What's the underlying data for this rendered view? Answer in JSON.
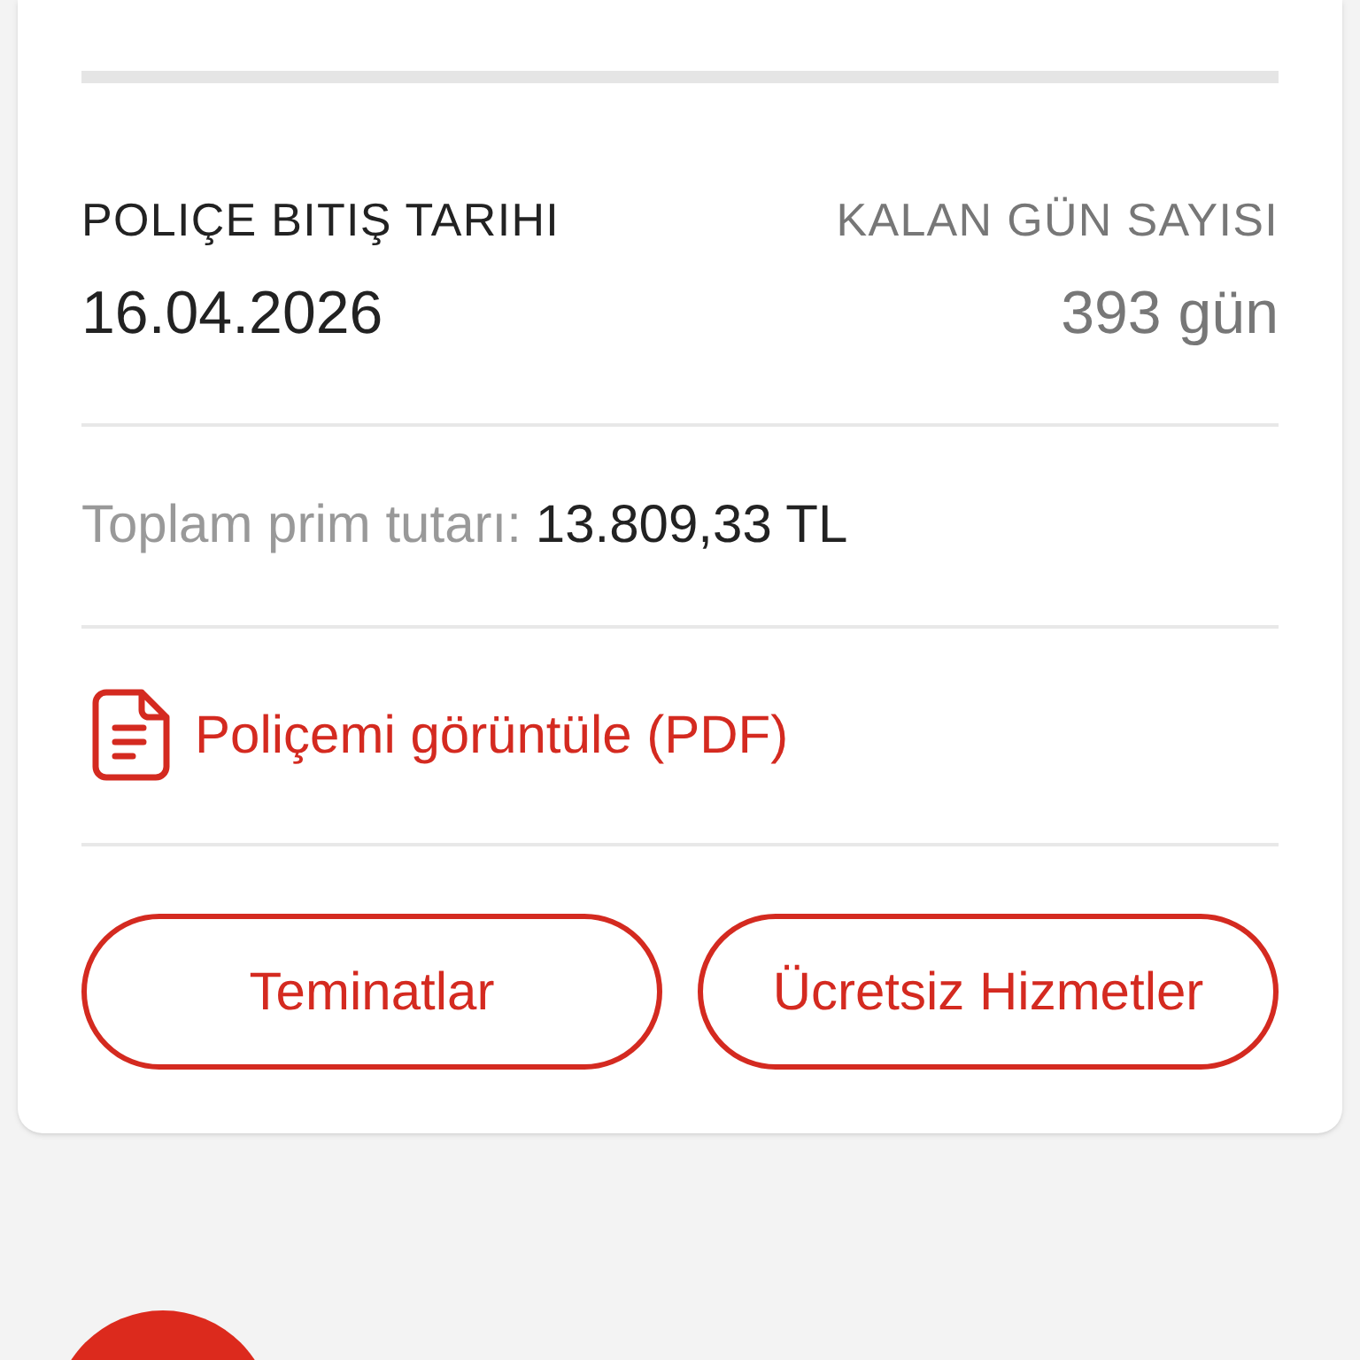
{
  "end_date": {
    "label": "POLIÇE BITIŞ TARIHI",
    "value": "16.04.2026"
  },
  "remaining_days": {
    "label": "KALAN GÜN SAYISI",
    "value": "393 gün"
  },
  "premium": {
    "label": "Toplam prim tutarı:",
    "value": "13.809,33 TL"
  },
  "pdf_link": "Poliçemi görüntüle (PDF)",
  "buttons": [
    "Teminatlar",
    "Ücretsiz Hizmetler"
  ]
}
